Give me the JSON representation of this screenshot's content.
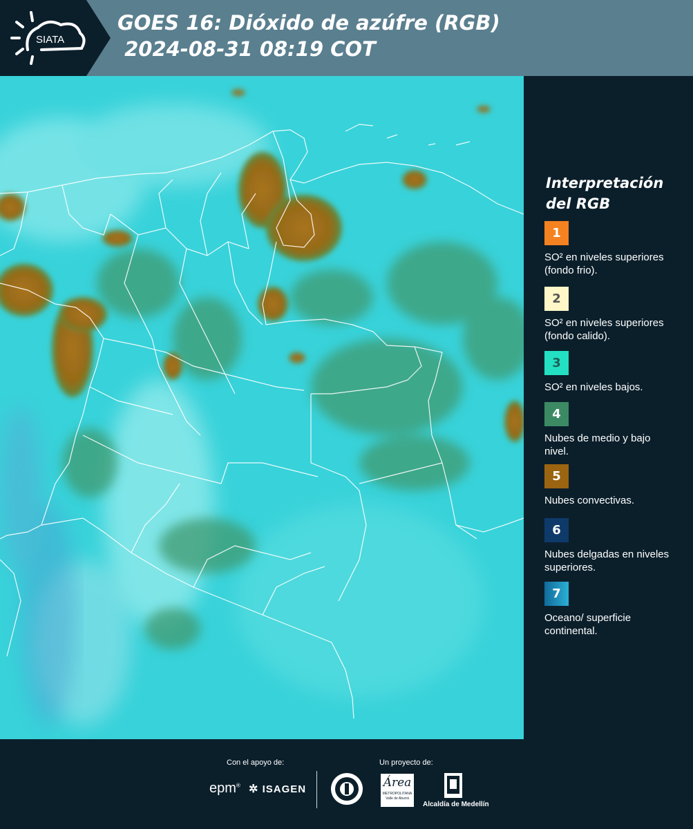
{
  "header": {
    "logo_text": "SIATA",
    "title_line1": "GOES 16: Dióxido de azúfre (RGB)",
    "title_line2": " 2024-08-31 08:19 COT"
  },
  "legend": {
    "title_line1": "Interpretación",
    "title_line2": "del RGB",
    "items": [
      {
        "number": "1",
        "label": "SO² en niveles superiores (fondo frio).",
        "color": "#f58220",
        "text_color": "#ffffff"
      },
      {
        "number": "2",
        "label": "SO² en niveles superiores (fondo calido).",
        "color": "#fff7c8",
        "text_color": "#555555"
      },
      {
        "number": "3",
        "label": "SO² en niveles bajos.",
        "color": "#23e0c2",
        "text_color": "#1f5f58"
      },
      {
        "number": "4",
        "label": "Nubes de medio y bajo nivel.",
        "color": "#3c8a64",
        "text_color": "#ffffff"
      },
      {
        "number": "5",
        "label": "Nubes convectivas.",
        "color": "#9b6410",
        "text_color": "#ffffff"
      },
      {
        "number": "6",
        "label": "Nubes delgadas en niveles superiores.",
        "color": "#0e3a6a",
        "text_color": "#ffffff"
      },
      {
        "number": "7",
        "label": "Oceano/ superficie continental.",
        "color": "#1e93c0",
        "text_color": "#ffffff"
      }
    ]
  },
  "footer": {
    "support_caption": "Con el apoyo de:",
    "project_caption": "Un proyecto de:",
    "sponsor_epm": "epm",
    "sponsor_isagen": "ISAGEN",
    "partner_amva": "Área",
    "partner_amva_sub": "METROPOLITANA",
    "partner_amva_sub2": "Valle de Aburrá",
    "partner_alcaldia": "Alcaldía de Medellín"
  },
  "colors": {
    "header_bg": "#5a7f8f",
    "panel_bg": "#0b1f2b",
    "ocean_cyan": "#35cfd8",
    "cloud_brown": "#9b6410",
    "cloud_green": "#3c8a64"
  }
}
